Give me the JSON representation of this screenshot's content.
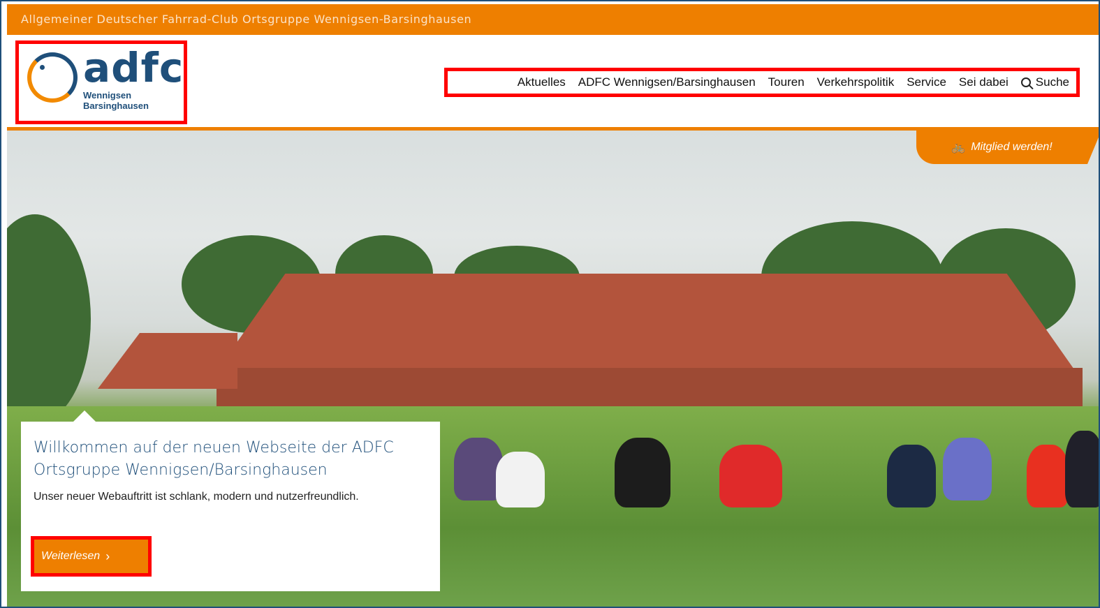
{
  "topbar": {
    "title": "Allgemeiner Deutscher Fahrrad-Club Ortsgruppe Wennigsen-Barsinghausen"
  },
  "logo": {
    "brand": "adfc",
    "line1": "Wennigsen",
    "line2": "Barsinghausen"
  },
  "nav": {
    "items": [
      "Aktuelles",
      "ADFC Wennigsen/Barsinghausen",
      "Touren",
      "Verkehrspolitik",
      "Service",
      "Sei dabei"
    ],
    "search_label": "Suche",
    "search_icon": "search-icon"
  },
  "member": {
    "label": "Mitglied werden!",
    "icon": "bicycle-icon"
  },
  "hero": {
    "title": "Willkommen auf der neuen Webseite der ADFC Ortsgruppe Wennigsen/Barsinghausen",
    "text": "Unser neuer Webauftritt ist schlank, modern und nutzerfreundlich.",
    "button_label": "Weiterlesen",
    "button_icon": "chevron-right-icon"
  },
  "colors": {
    "accent": "#ee7f00",
    "brand_blue": "#1f4f7a",
    "highlight_red": "#ff0000"
  }
}
